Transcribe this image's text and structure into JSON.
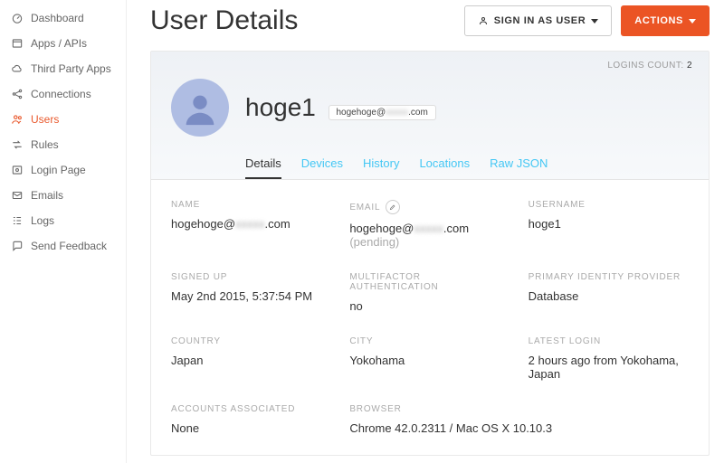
{
  "sidebar": {
    "items": [
      {
        "label": "Dashboard"
      },
      {
        "label": "Apps / APIs"
      },
      {
        "label": "Third Party Apps"
      },
      {
        "label": "Connections"
      },
      {
        "label": "Users"
      },
      {
        "label": "Rules"
      },
      {
        "label": "Login Page"
      },
      {
        "label": "Emails"
      },
      {
        "label": "Logs"
      },
      {
        "label": "Send Feedback"
      }
    ]
  },
  "header": {
    "title": "User Details",
    "sign_in_label": "SIGN IN AS USER",
    "actions_label": "ACTIONS"
  },
  "card": {
    "logins_count_label": "LOGINS COUNT:",
    "logins_count_value": "2",
    "display_name": "hoge1",
    "email_pill_left": "hogehoge@",
    "email_pill_mask": "xxxxx",
    "email_pill_right": ".com",
    "tabs": [
      {
        "label": "Details"
      },
      {
        "label": "Devices"
      },
      {
        "label": "History"
      },
      {
        "label": "Locations"
      },
      {
        "label": "Raw JSON"
      }
    ]
  },
  "fields": {
    "name": {
      "label": "NAME",
      "value_left": "hogehoge@",
      "value_mask": "xxxxx",
      "value_right": ".com"
    },
    "email": {
      "label": "EMAIL",
      "value_left": "hogehoge@",
      "value_mask": "xxxxx",
      "value_right": ".com",
      "pending": " (pending)"
    },
    "username": {
      "label": "USERNAME",
      "value": "hoge1"
    },
    "signed_up": {
      "label": "SIGNED UP",
      "value": "May 2nd 2015, 5:37:54 PM"
    },
    "mfa": {
      "label": "MULTIFACTOR AUTHENTICATION",
      "value": "no"
    },
    "provider": {
      "label": "PRIMARY IDENTITY PROVIDER",
      "value": "Database"
    },
    "country": {
      "label": "COUNTRY",
      "value": "Japan"
    },
    "city": {
      "label": "CITY",
      "value": "Yokohama"
    },
    "latest_login": {
      "label": "LATEST LOGIN",
      "value": "2 hours ago from Yokohama, Japan"
    },
    "accounts": {
      "label": "ACCOUNTS ASSOCIATED",
      "value": "None"
    },
    "browser": {
      "label": "BROWSER",
      "value": "Chrome 42.0.2311 / Mac OS X 10.10.3"
    }
  }
}
